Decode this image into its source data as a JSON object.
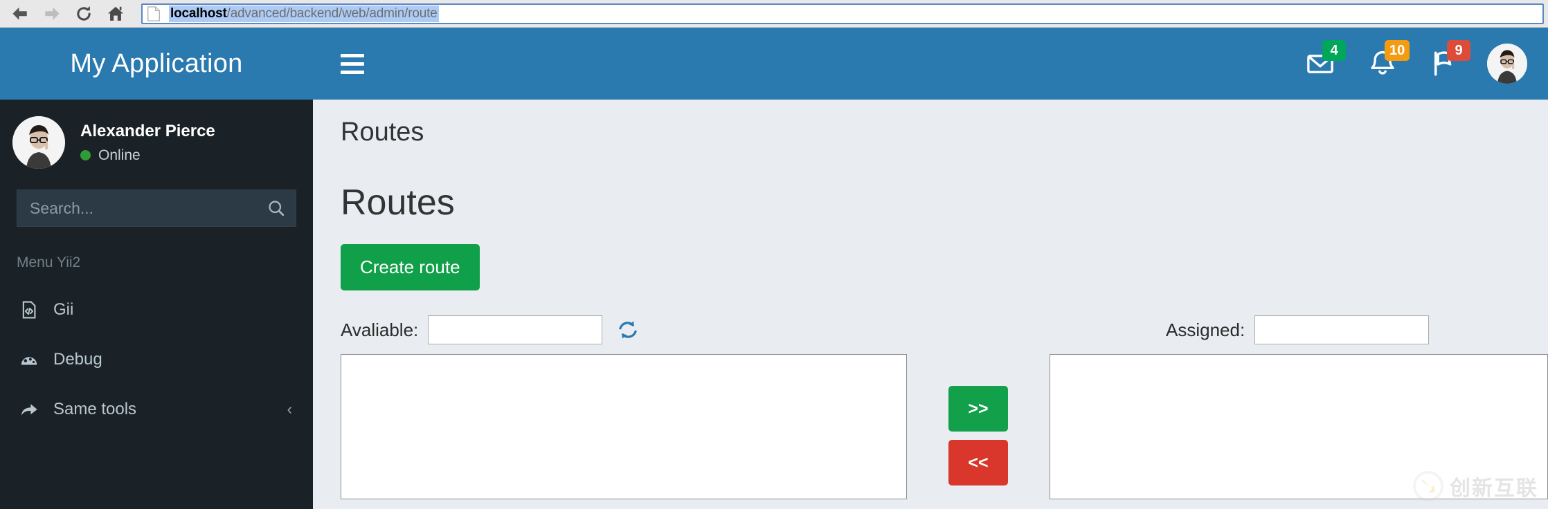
{
  "browser": {
    "back_label": "Back",
    "forward_label": "Forward",
    "reload_label": "Reload",
    "home_label": "Home",
    "url_host": "localhost",
    "url_path": "/advanced/backend/web/admin/route"
  },
  "sidebar": {
    "brand": "My Application",
    "user": {
      "name": "Alexander Pierce",
      "status": "Online",
      "status_color": "#2f9c36"
    },
    "search": {
      "placeholder": "Search...",
      "value": ""
    },
    "menu_header": "Menu Yii2",
    "items": [
      {
        "label": "Gii",
        "icon": "file-code-icon"
      },
      {
        "label": "Debug",
        "icon": "dashboard-icon"
      },
      {
        "label": "Same tools",
        "icon": "share-arrow-icon",
        "chevron": "‹"
      }
    ]
  },
  "navbar": {
    "menu_toggle": "Toggle navigation",
    "messages": {
      "icon": "envelope-icon",
      "badge": "4",
      "badge_color": "#00a65a"
    },
    "notifications": {
      "icon": "bell-icon",
      "badge": "10",
      "badge_color": "#f39c12"
    },
    "tasks": {
      "icon": "flag-icon",
      "badge": "9",
      "badge_color": "#dd4b39"
    },
    "avatar": "user-avatar"
  },
  "content": {
    "header": "Routes",
    "page_title": "Routes",
    "create_button": "Create route",
    "available": {
      "label": "Avaliable:",
      "filter_value": "",
      "refresh_icon": "refresh-icon",
      "items": []
    },
    "assigned": {
      "label": "Assigned:",
      "filter_value": "",
      "items": []
    },
    "transfer": {
      "add_label": ">>",
      "remove_label": "<<",
      "add_color": "#13a04b",
      "remove_color": "#d9372b"
    }
  },
  "watermark": {
    "text": "创新互联"
  },
  "theme": {
    "primary": "#2a7ab0",
    "sidebar_bg": "#1b2227",
    "content_bg": "#e9edf2",
    "success": "#11a04a"
  }
}
